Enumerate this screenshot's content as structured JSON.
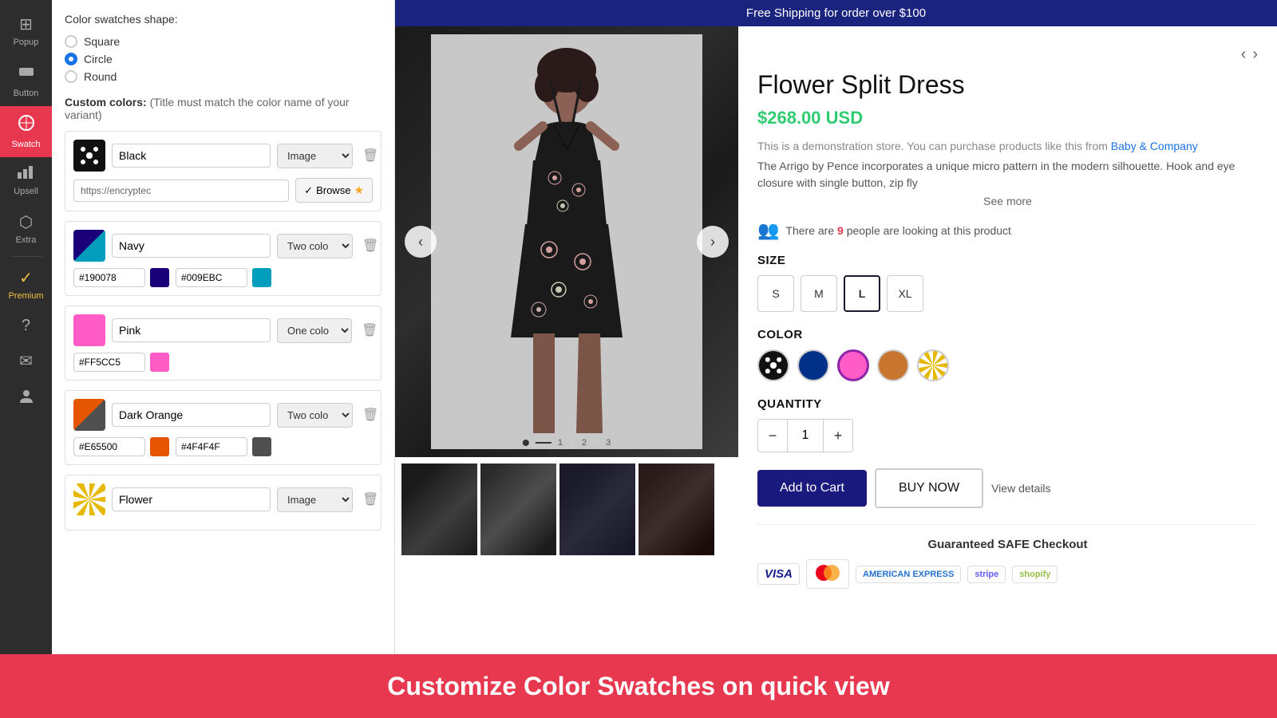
{
  "sidebar": {
    "items": [
      {
        "id": "popup",
        "label": "Popup",
        "icon": "⊞",
        "active": false
      },
      {
        "id": "button",
        "label": "Button",
        "icon": "⬛",
        "active": false
      },
      {
        "id": "swatch",
        "label": "Swatch",
        "icon": "🎨",
        "active": true
      },
      {
        "id": "upsell",
        "label": "Upsell",
        "icon": "📊",
        "active": false
      },
      {
        "id": "extra",
        "label": "Extra",
        "icon": "⬡",
        "active": false
      },
      {
        "id": "premium",
        "label": "Premium",
        "icon": "✓",
        "special": "premium"
      },
      {
        "id": "help",
        "label": "?",
        "icon": "?",
        "active": false
      },
      {
        "id": "mail",
        "label": "Mail",
        "icon": "✉",
        "active": false
      },
      {
        "id": "user",
        "label": "User",
        "icon": "👤",
        "active": false
      }
    ]
  },
  "left_panel": {
    "shape_section_title": "Color swatches shape:",
    "shapes": [
      {
        "id": "square",
        "label": "Square",
        "selected": false
      },
      {
        "id": "circle",
        "label": "Circle",
        "selected": true
      },
      {
        "id": "round",
        "label": "Round",
        "selected": false
      }
    ],
    "custom_colors_label": "Custom colors:",
    "custom_colors_note": "(Title must match the color name of your variant)",
    "colors": [
      {
        "id": "black",
        "name": "Black",
        "type": "Image",
        "swatch_bg": "#111",
        "pattern": "flower",
        "url": "https://encryptec",
        "hex1": null,
        "hex2": null,
        "has_url": true
      },
      {
        "id": "navy",
        "name": "Navy",
        "type": "Two colo",
        "swatch_bg1": "#190078",
        "swatch_bg2": "#009EBC",
        "hex1": "#190078",
        "hex1_color": "#190078",
        "hex2": "#009EBC",
        "hex2_color": "#009EBC",
        "has_url": false
      },
      {
        "id": "pink",
        "name": "Pink",
        "type": "One colo",
        "swatch_bg": "#FF5CC8",
        "hex1": "#FF5CC5",
        "hex1_color": "#FF5CC5",
        "has_url": false
      },
      {
        "id": "dark-orange",
        "name": "Dark Orange",
        "type": "Two colo",
        "swatch_bg1": "#E65500",
        "swatch_bg2": "#4F4F4F",
        "hex1": "#E65500",
        "hex1_color": "#E65500",
        "hex2": "#4F4F4F",
        "hex2_color": "#4F4F4F",
        "has_url": false
      },
      {
        "id": "flower",
        "name": "Flower",
        "type": "Image",
        "pattern": "wave",
        "has_url": false
      }
    ]
  },
  "product": {
    "shipping_bar": "Free Shipping for order over $100",
    "title": "Flower Split Dress",
    "price": "$268.00 USD",
    "description_link_text": "Baby & Company",
    "description_intro": "This is a demonstration store. You can purchase products like this from",
    "description_body": "The Arrigo by Pence incorporates a unique micro pattern in the modern silhouette. Hook and eye closure with single button, zip fly",
    "see_more": "See more",
    "viewers_text": "There are",
    "viewers_count": "9",
    "viewers_suffix": "people are looking at this product",
    "size_label": "SIZE",
    "sizes": [
      "S",
      "M",
      "L",
      "XL"
    ],
    "selected_size": "L",
    "color_label": "COLOR",
    "colors": [
      "black-pattern",
      "navy",
      "pink",
      "orange",
      "yellow-wave"
    ],
    "selected_color": "pink",
    "quantity_label": "QUANTITY",
    "quantity": "1",
    "add_to_cart_label": "Add to Cart",
    "buy_now_label": "BUY NOW",
    "view_details_label": "View details",
    "safe_checkout_title": "Guaranteed SAFE Checkout",
    "payment_methods": [
      "VISA",
      "MC",
      "AMEX",
      "Stripe",
      "Shopify"
    ],
    "nav_prev": "‹",
    "nav_next": "›"
  },
  "bottom_banner": {
    "text": "Customize Color Swatches on quick view"
  }
}
